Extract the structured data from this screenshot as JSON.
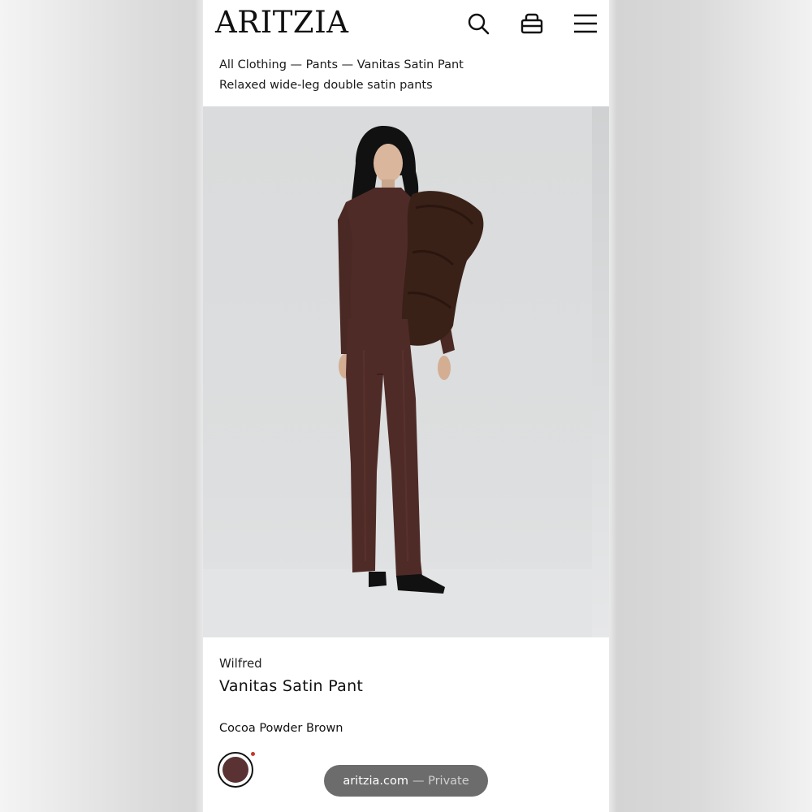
{
  "header": {
    "logo": "ARITZIA",
    "icons": [
      "search-icon",
      "bag-icon",
      "menu-icon"
    ]
  },
  "breadcrumb": "All Clothing — Pants — Vanitas Satin Pant",
  "subtitle": "Relaxed wide-leg double satin pants",
  "hero": {
    "image_alt": "Model wearing brown satin pants, long-sleeve top, and fur shawl"
  },
  "product": {
    "brand": "Wilfred",
    "name": "Vanitas Satin Pant",
    "color_name": "Cocoa Powder Brown",
    "swatch_color": "#5a3234"
  },
  "browser": {
    "domain": "aritzia.com",
    "mode": "— Private"
  },
  "colors": {
    "accent_dot": "#c0392b",
    "garment": "#4f2b27",
    "fur": "#3a2118"
  }
}
